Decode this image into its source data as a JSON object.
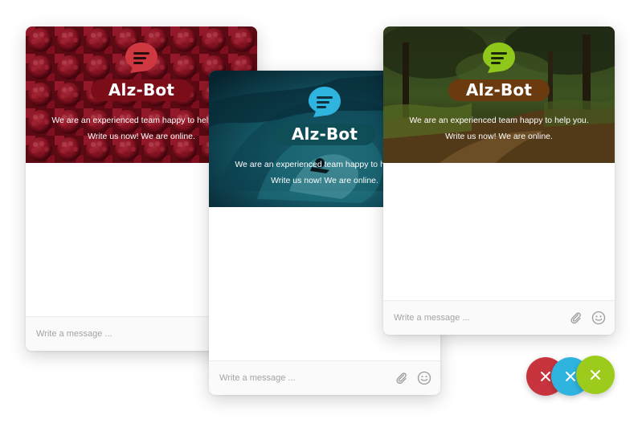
{
  "widgets": [
    {
      "theme": "raspberry",
      "bot_name": "Alz-Bot",
      "tagline_1": "We are an experienced team happy to help you.",
      "tagline_2": "Write us now! We are online.",
      "placeholder": "Write a message ...",
      "accent_color": "#c8343d",
      "name_pill_color": "#7a0d18",
      "icon": "chat-bubble-icon"
    },
    {
      "theme": "ocean-surf",
      "bot_name": "Alz-Bot",
      "tagline_1": "We are an experienced team happy to help you.",
      "tagline_2": "Write us now! We are online.",
      "placeholder": "Write a message ...",
      "accent_color": "#2fb4e0",
      "name_pill_color": "#0f4d57",
      "icon": "chat-bubble-icon"
    },
    {
      "theme": "forest",
      "bot_name": "Alz-Bot",
      "tagline_1": "We are an experienced team happy to help you.",
      "tagline_2": "Write us now! We are online.",
      "placeholder": "Write a message ...",
      "accent_color": "#8fc71a",
      "name_pill_color": "#6b3a0e",
      "icon": "chat-bubble-icon"
    }
  ],
  "launchers": [
    {
      "color": "#c8343d",
      "icon": "close-icon"
    },
    {
      "color": "#2fb4e0",
      "icon": "close-icon"
    },
    {
      "color": "#9dcb1c",
      "icon": "close-icon"
    }
  ],
  "composer_icons": [
    "paperclip-icon",
    "smiley-icon"
  ]
}
